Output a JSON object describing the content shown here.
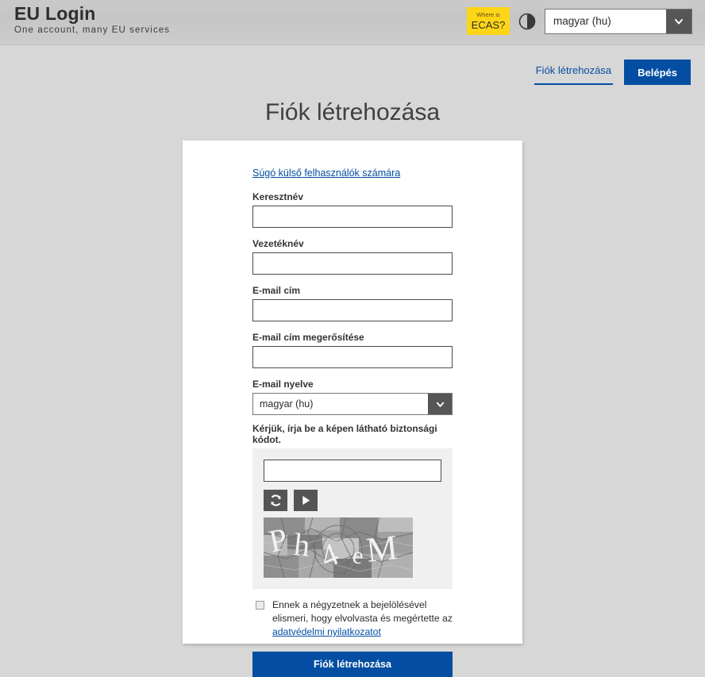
{
  "header": {
    "brand_title": "EU Login",
    "brand_subtitle": "One account, many EU services",
    "ecas_badge": {
      "line1": "Where is",
      "line2": "ECAS?"
    },
    "contrast_icon": "contrast-toggle-icon",
    "language_select": {
      "value": "magyar (hu)",
      "arrow_icon": "chevron-down-icon"
    }
  },
  "nav": {
    "create_account_tab": "Fiók létrehozása",
    "login_tab": "Belépés"
  },
  "page": {
    "title": "Fiók létrehozása"
  },
  "form": {
    "help_link": "Súgó külső felhasználók számára",
    "fields": [
      {
        "label": "Keresztnév",
        "value": "",
        "placeholder": ""
      },
      {
        "label": "Vezetéknév",
        "value": "",
        "placeholder": ""
      },
      {
        "label": "E-mail cím",
        "value": "",
        "placeholder": ""
      },
      {
        "label": "E-mail cím megerősítése",
        "value": "",
        "placeholder": ""
      }
    ],
    "email_language": {
      "label": "E-mail nyelve",
      "value": "magyar (hu)",
      "arrow_icon": "chevron-down-icon"
    },
    "captcha": {
      "label": "Kérjük, írja be a képen látható biztonsági kódot.",
      "input_value": "",
      "input_placeholder": "",
      "refresh_icon": "refresh-icon",
      "audio_icon": "play-icon",
      "image_text": "Ph4eM"
    },
    "consent": {
      "checked": false,
      "text_before": "Ennek a négyzetnek a bejelölésével elismeri, hogy elvolvasta és megértette az",
      "link_text": "adatvédelmi nyilatkozatot"
    },
    "submit_label": "Fiók létrehozása"
  },
  "colors": {
    "brand_blue": "#034ea2",
    "badge_yellow": "#ffd617",
    "page_background": "#d7d7d7",
    "card_background": "#ffffff",
    "captcha_panel": "#f0f0f0",
    "select_arrow": "#565656"
  }
}
